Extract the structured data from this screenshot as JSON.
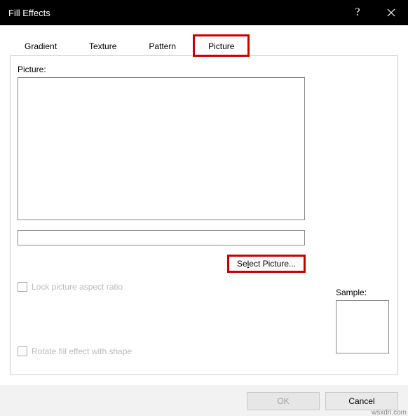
{
  "titlebar": {
    "title": "Fill Effects",
    "help_symbol": "?",
    "close_label": "Close"
  },
  "tabs": {
    "gradient": "Gradient",
    "texture": "Texture",
    "pattern": "Pattern",
    "picture": "Picture"
  },
  "picture_section": {
    "label": "Picture:",
    "filename": "",
    "select_button_prefix": "Se",
    "select_button_underline": "l",
    "select_button_suffix": "ect Picture..."
  },
  "lock_aspect": {
    "label": "Lock picture aspect ratio"
  },
  "sample": {
    "label": "Sample:"
  },
  "rotate": {
    "label": "Rotate fill effect with shape"
  },
  "buttons": {
    "ok": "OK",
    "cancel": "Cancel"
  },
  "watermark": "wsxdn.com"
}
